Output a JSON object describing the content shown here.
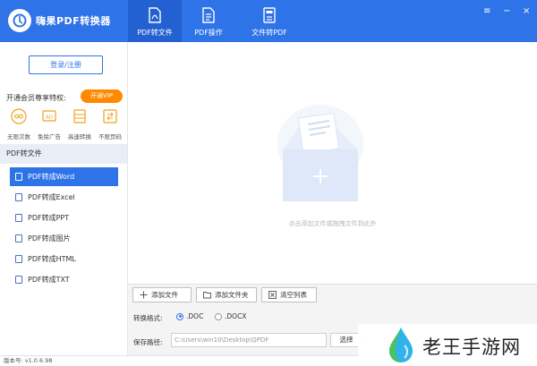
{
  "app": {
    "title": "嗨果PDF转换器"
  },
  "tabs": [
    {
      "label": "PDF转文件",
      "icon": "pdf-file-icon",
      "active": true
    },
    {
      "label": "PDF操作",
      "icon": "document-icon",
      "active": false
    },
    {
      "label": "文件转PDF",
      "icon": "file-convert-icon",
      "active": false
    }
  ],
  "window_controls": {
    "settings": "≡",
    "minimize": "−",
    "close": "×"
  },
  "sidebar": {
    "login_label": "登录/注册",
    "vip_title": "开通会员尊享特权:",
    "vip_button": "开通VIP",
    "perks": [
      {
        "label": "无限次数",
        "icon": "infinity-icon"
      },
      {
        "label": "免除广告",
        "icon": "no-ad-icon"
      },
      {
        "label": "高速转换",
        "icon": "speed-icon"
      },
      {
        "label": "不限页码",
        "icon": "page-icon"
      }
    ],
    "section_title": "PDF转文件",
    "items": [
      {
        "label": "PDF转成Word",
        "icon": "word-icon",
        "active": true
      },
      {
        "label": "PDF转成Excel",
        "icon": "excel-icon",
        "active": false
      },
      {
        "label": "PDF转成PPT",
        "icon": "ppt-icon",
        "active": false
      },
      {
        "label": "PDF转成图片",
        "icon": "image-icon",
        "active": false
      },
      {
        "label": "PDF转成HTML",
        "icon": "html-icon",
        "active": false
      },
      {
        "label": "PDF转成TXT",
        "icon": "txt-icon",
        "active": false
      }
    ]
  },
  "main": {
    "drop_hint": "点击添加文件或拖拽文件到此外"
  },
  "toolbar": {
    "add_file": "添加文件",
    "add_folder": "添加文件夹",
    "clear_list": "清空列表",
    "format_label": "转换格式:",
    "format_options": [
      ".DOC",
      ".DOCX"
    ],
    "format_selected": ".DOC",
    "path_label": "保存路径:",
    "path_value": "C:\\Users\\win10\\Desktop\\QPDF",
    "choose_button": "选择"
  },
  "status": {
    "version": "版本号: v1.0.6.98"
  },
  "watermark": {
    "text": "老王手游网"
  },
  "colors": {
    "primary": "#2f73e8",
    "vip": "#ff8a00"
  }
}
